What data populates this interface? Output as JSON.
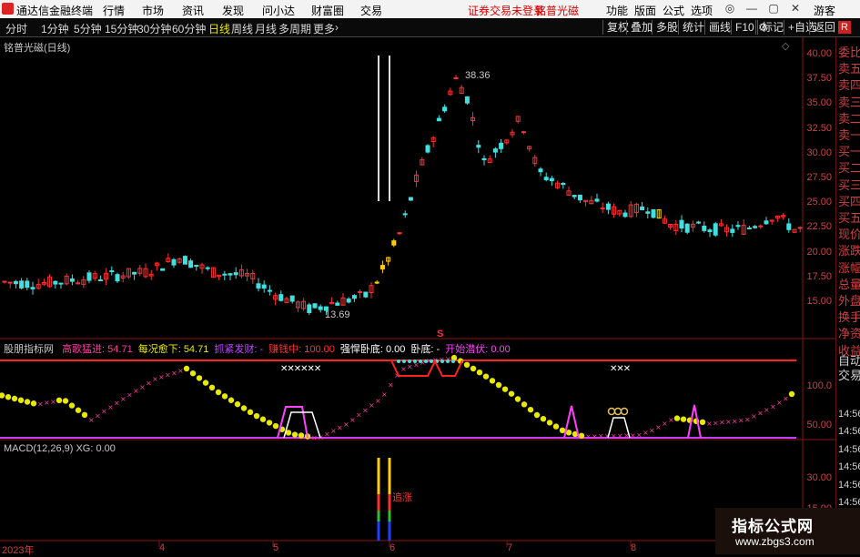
{
  "app": {
    "title": "通达信金融终端",
    "menu": [
      "行情",
      "市场",
      "资讯",
      "发现",
      "问小达",
      "财富圈",
      "交易"
    ],
    "notice_login": "证券交易未登录",
    "notice_stock": "铭普光磁",
    "right_menu": [
      "功能",
      "版面",
      "公式",
      "选项"
    ],
    "guest": "游客",
    "r_badge": "R"
  },
  "toolbar": {
    "periods": [
      "分时",
      "1分钟",
      "5分钟",
      "15分钟",
      "30分钟",
      "60分钟",
      "日线",
      "周线",
      "月线",
      "多周期",
      "更多"
    ],
    "active": "日线",
    "right_buttons": [
      "复权",
      "叠加",
      "多股",
      "统计",
      "画线",
      "F10",
      "标记",
      "+自选",
      "返回"
    ]
  },
  "sidebar": {
    "items": [
      "委比",
      "卖五",
      "卖四",
      "卖三",
      "卖二",
      "卖一",
      "买一",
      "买二",
      "买三",
      "买四",
      "买五",
      "现价",
      "涨跌",
      "涨幅",
      "总量",
      "外盘",
      "换手",
      "净资",
      "收益",
      "自动",
      "交易",
      "14:56",
      "14:56",
      "14:56",
      "14:56",
      "14:56",
      "14:56",
      "14:56",
      "14:56"
    ]
  },
  "main_chart": {
    "title": "铭普光磁(日线)",
    "yaxis": [
      "40.00",
      "37.50",
      "35.00",
      "32.50",
      "30.00",
      "27.50",
      "25.00",
      "22.50",
      "20.00",
      "17.50",
      "15.00"
    ],
    "high_label": "38.36",
    "low_label": "13.69"
  },
  "indicator": {
    "title": "股朋指标网",
    "items": [
      {
        "label": "高歌猛进: 54.71",
        "color": "#ff3aa0"
      },
      {
        "label": "每况愈下: 54.71",
        "color": "#e8e800"
      },
      {
        "label": "抓紧发财: -",
        "color": "#c040ff"
      },
      {
        "label": "赚钱中: 100.00",
        "color": "#ff3030"
      },
      {
        "label": "强悍卧底: 0.00",
        "color": "#ffffff"
      },
      {
        "label": "卧底: -",
        "color": "#ffffff"
      },
      {
        "label": "开始潜伏: 0.00",
        "color": "#ff40ff"
      }
    ],
    "yaxis": [
      "100.0",
      "50.00"
    ],
    "markers": [
      "✕✕✕✕✕✕",
      "✕✕✕"
    ],
    "s_mark": "S"
  },
  "macd": {
    "title": "MACD(12,26,9) XG: 0.00",
    "yaxis": [
      "30.00",
      "15.00"
    ],
    "annotation": "追涨"
  },
  "xaxis": [
    "2023年",
    "4",
    "5",
    "6",
    "7",
    "8"
  ],
  "watermark": {
    "line1": "指标公式网",
    "line2": "www.zbgs3.com"
  }
}
